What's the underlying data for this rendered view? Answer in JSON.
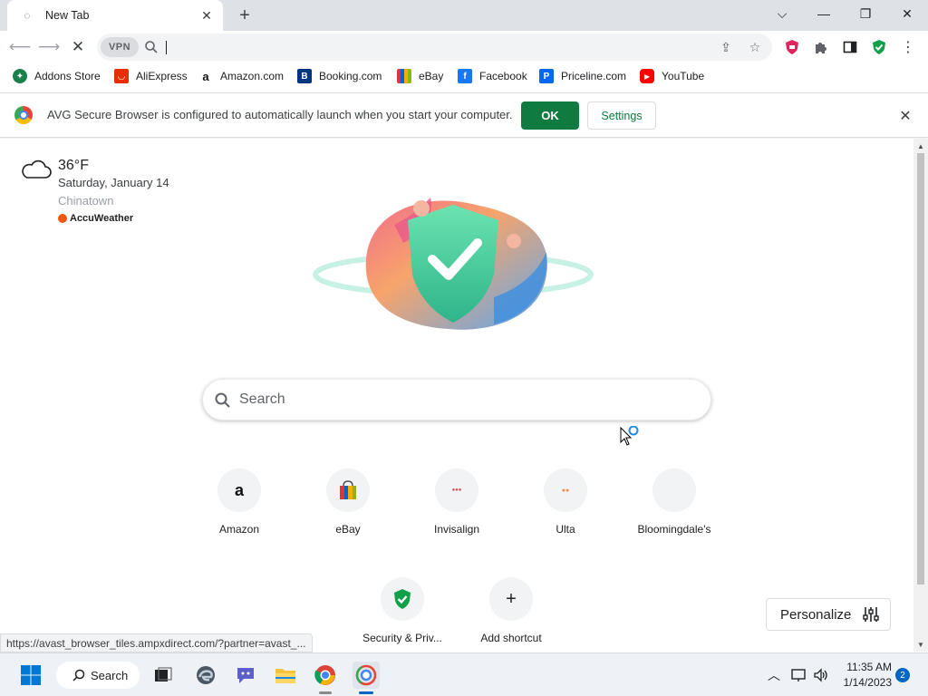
{
  "tab": {
    "title": "New Tab"
  },
  "omnibox": {
    "vpn_label": "VPN",
    "value": ""
  },
  "bookmarks": [
    {
      "label": "Addons Store",
      "icon": "addons-store-icon",
      "color": "#1a7f4b"
    },
    {
      "label": "AliExpress",
      "icon": "aliexpress-icon",
      "color": "#e62e04"
    },
    {
      "label": "Amazon.com",
      "icon": "amazon-icon",
      "color": "#232f3e"
    },
    {
      "label": "Booking.com",
      "icon": "booking-icon",
      "color": "#003580"
    },
    {
      "label": "eBay",
      "icon": "ebay-icon",
      "color": "#e53238"
    },
    {
      "label": "Facebook",
      "icon": "facebook-icon",
      "color": "#1877f2"
    },
    {
      "label": "Priceline.com",
      "icon": "priceline-icon",
      "color": "#0068ef"
    },
    {
      "label": "YouTube",
      "icon": "youtube-icon",
      "color": "#ff0000"
    }
  ],
  "infobar": {
    "message": "AVG Secure Browser is configured to automatically launch when you start your computer.",
    "ok_label": "OK",
    "settings_label": "Settings"
  },
  "weather": {
    "temperature": "36°F",
    "date": "Saturday, January 14",
    "location": "Chinatown",
    "provider": "AccuWeather"
  },
  "search": {
    "placeholder": "Search"
  },
  "shortcuts": [
    {
      "label": "Amazon",
      "icon": "amazon-icon"
    },
    {
      "label": "eBay",
      "icon": "ebay-bag-icon"
    },
    {
      "label": "Invisalign",
      "icon": "invisalign-icon"
    },
    {
      "label": "Ulta",
      "icon": "ulta-icon"
    },
    {
      "label": "Bloomingdale's",
      "icon": "bloomingdales-icon"
    },
    {
      "label": "Security & Priv...",
      "icon": "shield-check-icon"
    },
    {
      "label": "Add shortcut",
      "icon": "plus-icon"
    }
  ],
  "personalize_label": "Personalize",
  "status_url": "https://avast_browser_tiles.ampxdirect.com/?partner=avast_...",
  "taskbar": {
    "search_label": "Search",
    "time": "11:35 AM",
    "date": "1/14/2023",
    "notification_count": "2"
  },
  "colors": {
    "accent_green": "#0f7b41",
    "tab_strip": "#dee1e6"
  }
}
